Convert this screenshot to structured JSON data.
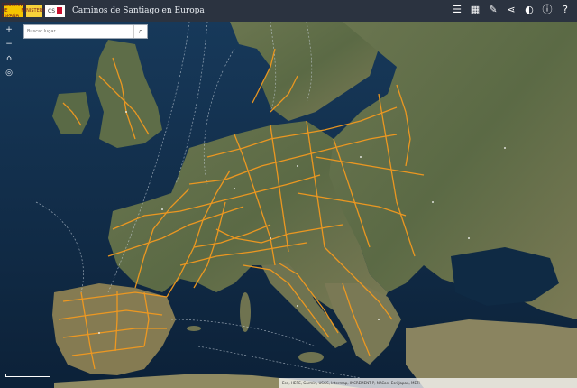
{
  "header": {
    "title": "Caminos de Santiago en Europa",
    "logo_es_text": "GOBIERNO DE ESPAÑA",
    "logo_ministry_text": "MINISTERIO",
    "logo_cs_text": "CS"
  },
  "search": {
    "placeholder": "Buscar lugar"
  },
  "toolbar": {
    "icons": [
      "list-icon",
      "grid-icon",
      "measure-icon",
      "share-icon",
      "compass-icon",
      "info-icon",
      "help-icon"
    ]
  },
  "left_controls": [
    "plus-icon",
    "minus-icon",
    "home-icon",
    "locate-icon"
  ],
  "colors": {
    "route": "#f39a1f",
    "sea": "#0f2a44",
    "land": "#5c6a44",
    "topbar": "#2b3340"
  },
  "attribution": "Esri, HERE, Garmin, USGS, Intermap, INCREMENT P, NRCan, Esri Japan, METI"
}
